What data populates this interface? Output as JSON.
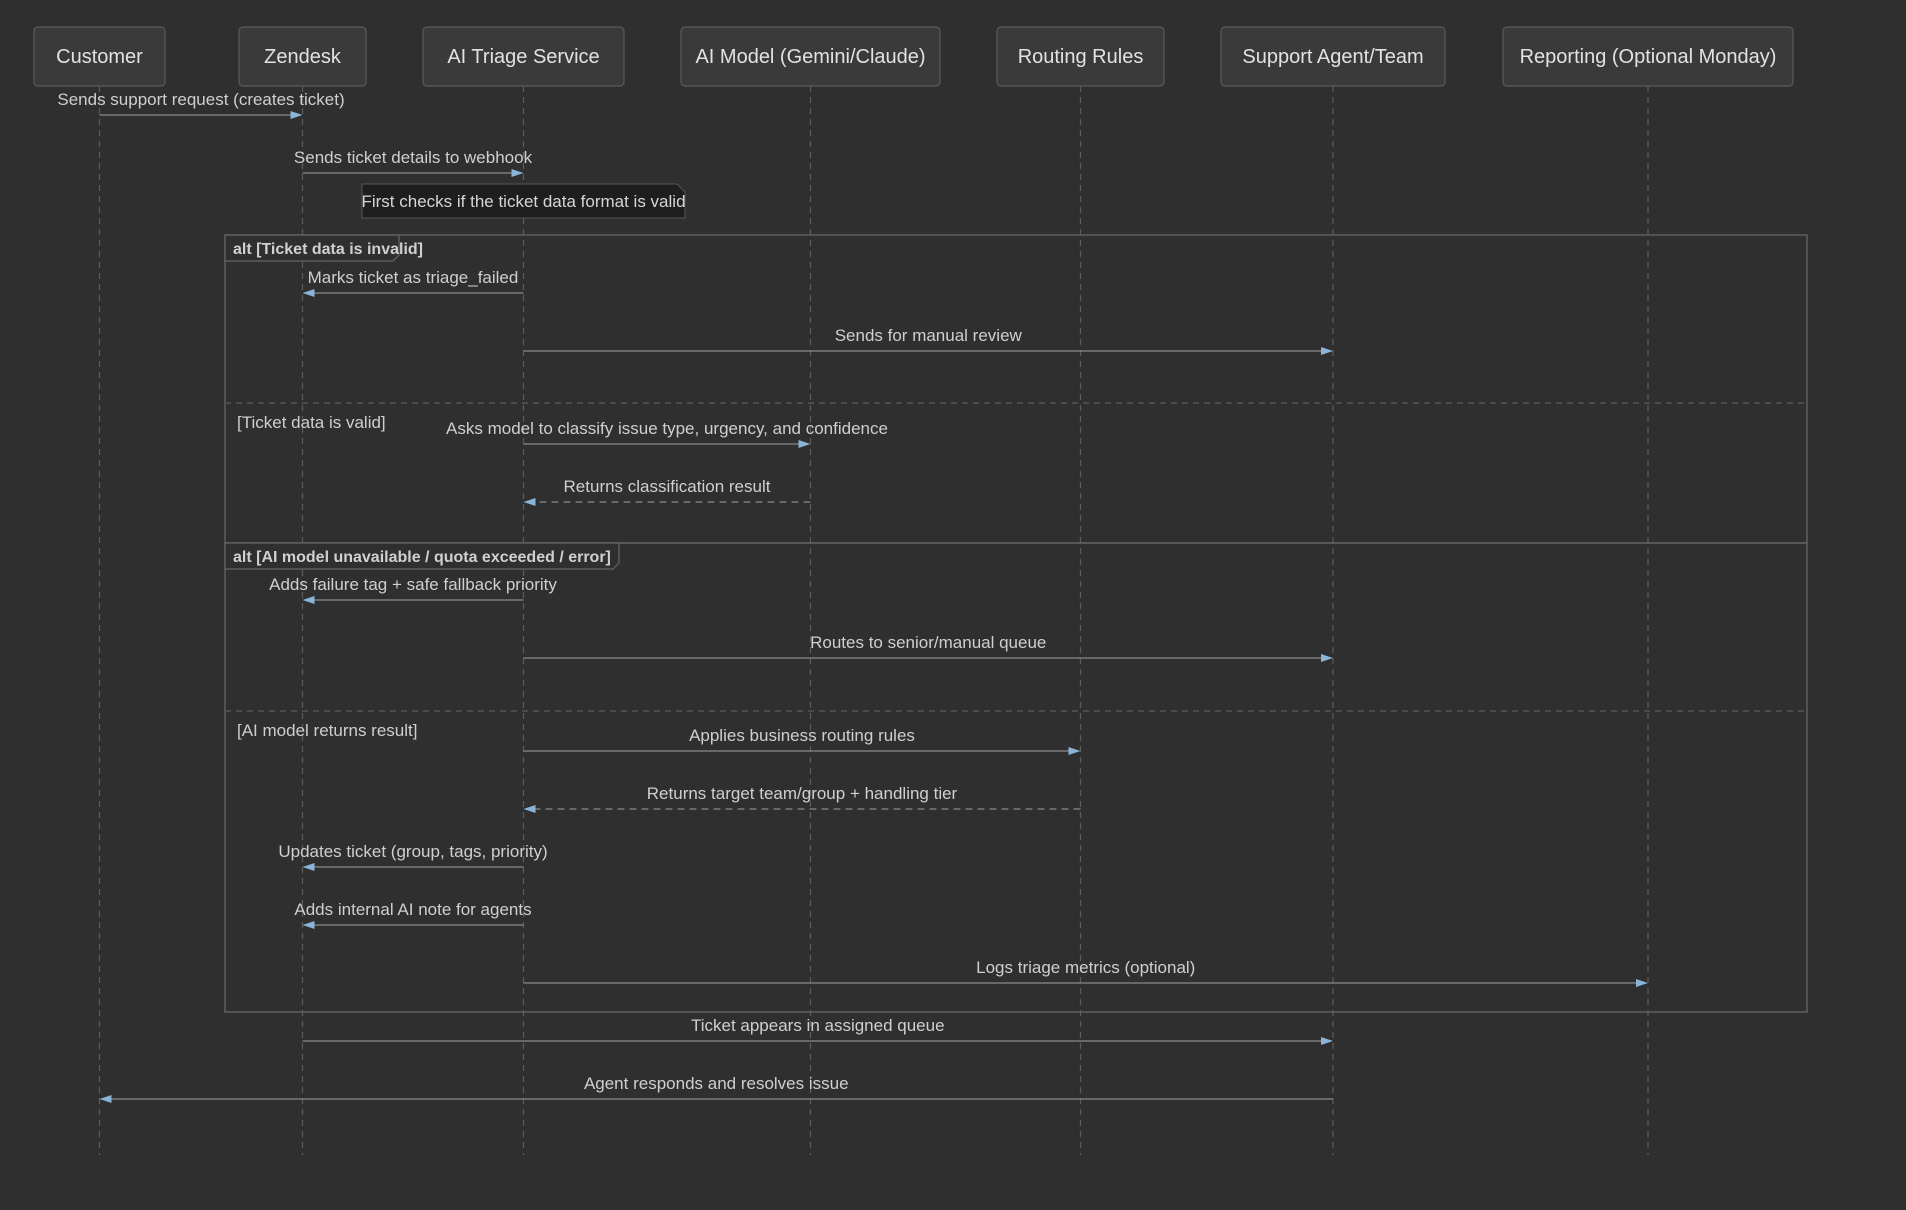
{
  "participants": [
    {
      "key": "customer",
      "label": "Customer"
    },
    {
      "key": "zendesk",
      "label": "Zendesk"
    },
    {
      "key": "triage",
      "label": "AI Triage Service"
    },
    {
      "key": "model",
      "label": "AI Model (Gemini/Claude)"
    },
    {
      "key": "rules",
      "label": "Routing Rules"
    },
    {
      "key": "agent",
      "label": "Support Agent/Team"
    },
    {
      "key": "reporting",
      "label": "Reporting (Optional Monday)"
    }
  ],
  "messages": [
    {
      "from": "customer",
      "to": "zendesk",
      "text": "Sends support request (creates ticket)",
      "style": "solid"
    },
    {
      "from": "zendesk",
      "to": "triage",
      "text": "Sends ticket details to webhook",
      "style": "solid"
    },
    {
      "from": "triage",
      "to": "zendesk",
      "text": "Marks ticket as triage_failed",
      "style": "solid"
    },
    {
      "from": "triage",
      "to": "agent",
      "text": "Sends for manual review",
      "style": "solid"
    },
    {
      "from": "triage",
      "to": "model",
      "text": "Asks model to classify issue type, urgency, and confidence",
      "style": "solid"
    },
    {
      "from": "model",
      "to": "triage",
      "text": "Returns classification result",
      "style": "dashed"
    },
    {
      "from": "triage",
      "to": "zendesk",
      "text": "Adds failure tag + safe fallback priority",
      "style": "solid"
    },
    {
      "from": "triage",
      "to": "agent",
      "text": "Routes to senior/manual queue",
      "style": "solid"
    },
    {
      "from": "triage",
      "to": "rules",
      "text": "Applies business routing rules",
      "style": "solid"
    },
    {
      "from": "rules",
      "to": "triage",
      "text": "Returns target team/group + handling tier",
      "style": "dashed"
    },
    {
      "from": "triage",
      "to": "zendesk",
      "text": "Updates ticket (group, tags, priority)",
      "style": "solid"
    },
    {
      "from": "triage",
      "to": "zendesk",
      "text": "Adds internal AI note for agents",
      "style": "solid"
    },
    {
      "from": "triage",
      "to": "reporting",
      "text": "Logs triage metrics (optional)",
      "style": "solid"
    },
    {
      "from": "zendesk",
      "to": "agent",
      "text": "Ticket appears in assigned queue",
      "style": "solid"
    },
    {
      "from": "agent",
      "to": "customer",
      "text": "Agent responds and resolves issue",
      "style": "solid"
    }
  ],
  "notes": [
    {
      "over": "triage",
      "text": "First checks if the ticket data format is valid"
    }
  ],
  "fragments": [
    {
      "type": "alt",
      "label": "alt [Ticket data is invalid]",
      "else_label": "[Ticket data is valid]"
    },
    {
      "type": "alt",
      "label": "alt [AI model unavailable / quota exceeded / error]",
      "else_label": "[AI model returns result]"
    }
  ],
  "colors": {
    "background": "#2f2f2f",
    "actor_fill": "#3a3a3a",
    "arrow_head": "#8ab4d8"
  }
}
